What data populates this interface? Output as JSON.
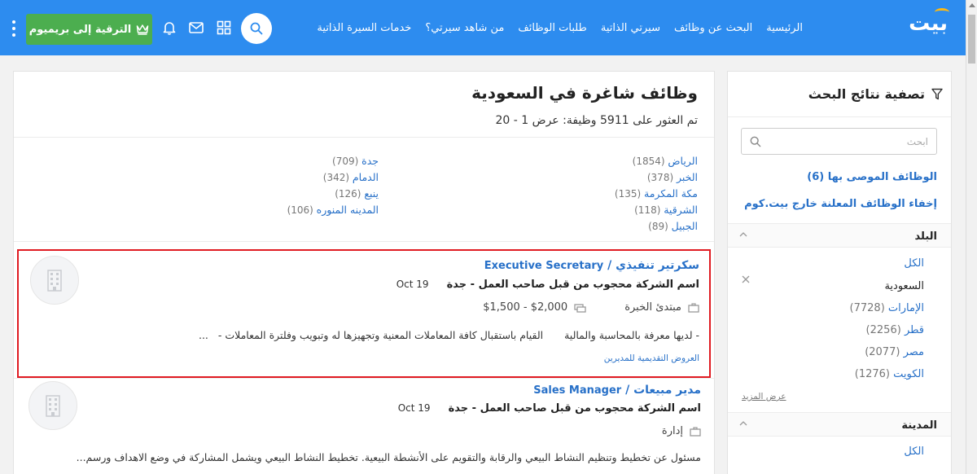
{
  "nav": {
    "logo": "بيت",
    "links": [
      "الرئيسية",
      "البحث عن وظائف",
      "سيرتي الذاتية",
      "طلبات الوظائف",
      "من شاهد سيرتي؟",
      "خدمات السيرة الذاتية"
    ],
    "upgrade_label": "الترقية إلى بريميوم"
  },
  "main": {
    "title": "وظائف شاغرة في السعودية",
    "subtitle": "تم العثور على 5911 وظيفة: عرض 1 - 20",
    "cities_right": [
      {
        "name": "الرياض",
        "count": "(1854)"
      },
      {
        "name": "الخبر",
        "count": "(378)"
      },
      {
        "name": "مكة المكرمة",
        "count": "(135)"
      },
      {
        "name": "الشرقية",
        "count": "(118)"
      },
      {
        "name": "الجبيل",
        "count": "(89)"
      }
    ],
    "cities_left": [
      {
        "name": "جدة",
        "count": "(709)"
      },
      {
        "name": "الدمام",
        "count": "(342)"
      },
      {
        "name": "ينبع",
        "count": "(126)"
      },
      {
        "name": "المدينه المنوره",
        "count": "(106)"
      }
    ]
  },
  "jobs": [
    {
      "title_ar": "سكرتير تنفيذي",
      "title_en": "Executive Secretary",
      "company": "اسم الشركة محجوب من قبل صاحب العمل - جدة",
      "date": "Oct 19",
      "experience": "مبتدئ الخبرة",
      "salary": "$1,500 - $2,000",
      "desc_1": "لديها معرفة بالمحاسبة والمالية",
      "desc_2": "القيام باستقبال كافة المعاملات المعنية وتجهيزها له وتبويب وفلترة المعاملات",
      "ellipsis": "...",
      "link": "العروض التقديمية للمديرين"
    },
    {
      "title_ar": "مدير مبيعات",
      "title_en": "Sales Manager",
      "company": "اسم الشركة محجوب من قبل صاحب العمل - جدة",
      "date": "Oct 19",
      "category": "إدارة",
      "desc": "مسئول عن تخطيط وتنظيم النشاط البيعي والرقابة والتقويم على الأنشطة البيعية. تخطيط النشاط البيعي ويشمل المشاركة في وضع الاهداف ورسم..."
    }
  ],
  "sidebar": {
    "title": "تصفية نتائج البحث",
    "search_placeholder": "ابحث",
    "recommended": "الوظائف الموصى بها (6)",
    "hide_external": "إخفاء الوظائف المعلنة خارج بيت.كوم",
    "country_label": "البلد",
    "countries": [
      {
        "name": "الكل",
        "count": ""
      },
      {
        "name": "السعودية",
        "count": ""
      },
      {
        "name": "الإمارات",
        "count": "(7728)"
      },
      {
        "name": "قطر",
        "count": "(2256)"
      },
      {
        "name": "مصر",
        "count": "(2077)"
      },
      {
        "name": "الكويت",
        "count": "(1276)"
      }
    ],
    "show_more": "عرض المزيد",
    "city_label": "المدينة",
    "city_all": "الكل"
  },
  "colors": {
    "nav_bg": "#2d8cef",
    "upgrade_bg": "#4cae4f",
    "link": "#2770c8",
    "highlight_border": "#e01b22"
  }
}
